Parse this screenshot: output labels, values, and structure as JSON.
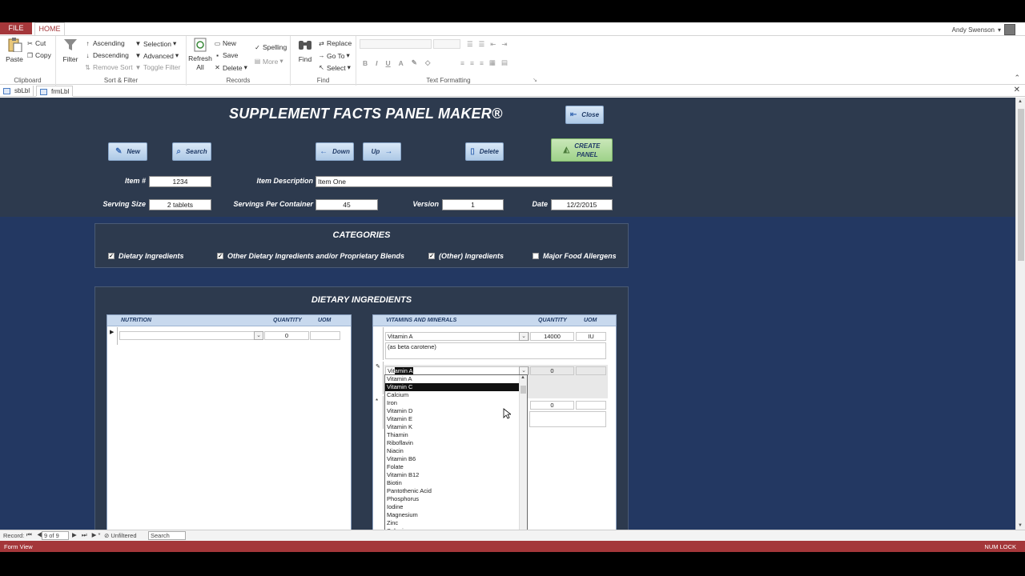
{
  "ribbon": {
    "file_tab": "FILE",
    "home_tab": "HOME",
    "user": "Andy Swenson",
    "clipboard": {
      "paste": "Paste",
      "cut": "Cut",
      "copy": "Copy",
      "label": "Clipboard"
    },
    "sort_filter": {
      "filter": "Filter",
      "ascending": "Ascending",
      "descending": "Descending",
      "remove_sort": "Remove Sort",
      "selection": "Selection",
      "advanced": "Advanced",
      "toggle_filter": "Toggle Filter",
      "label": "Sort & Filter"
    },
    "records": {
      "refresh": "Refresh",
      "refresh_all": "All",
      "new": "New",
      "save": "Save",
      "delete": "Delete",
      "spelling": "Spelling",
      "more": "More",
      "label": "Records"
    },
    "find": {
      "find": "Find",
      "replace": "Replace",
      "go_to": "Go To",
      "select": "Select",
      "label": "Find"
    },
    "text_formatting": {
      "bold": "B",
      "italic": "I",
      "underline": "U",
      "label": "Text Formatting"
    }
  },
  "doc_tabs": [
    "sbLbl",
    "frmLbl"
  ],
  "form": {
    "title": "SUPPLEMENT FACTS PANEL MAKER®",
    "buttons": {
      "close": "Close",
      "new": "New",
      "search": "Search",
      "down": "Down",
      "up": "Up",
      "delete": "Delete",
      "create_line1": "CREATE",
      "create_line2": "PANEL"
    },
    "fields": {
      "item_label": "Item #",
      "item_value": "1234",
      "desc_label": "Item Description",
      "desc_value": "Item One",
      "serving_label": "Serving Size",
      "serving_value": "2 tablets",
      "servings_label": "Servings Per Container",
      "servings_value": "45",
      "version_label": "Version",
      "version_value": "1",
      "date_label": "Date",
      "date_value": "12/2/2015"
    },
    "categories": {
      "title": "CATEGORIES",
      "items": [
        {
          "label": "Dietary Ingredients",
          "checked": true
        },
        {
          "label": "Other Dietary Ingredients and/or Proprietary Blends",
          "checked": true
        },
        {
          "label": "(Other) Ingredients",
          "checked": true
        },
        {
          "label": "Major Food Allergens",
          "checked": false
        }
      ]
    },
    "dietary": {
      "title": "DIETARY INGREDIENTS",
      "nutrition": {
        "col_name": "NUTRITION",
        "col_qty": "QUANTITY",
        "col_uom": "UOM",
        "row_qty": "0"
      },
      "vitamins": {
        "col_name": "VITAMINS AND MINERALS",
        "col_qty": "QUANTITY",
        "col_uom": "UOM",
        "row1_name": "Vitamin A",
        "row1_qty": "14000",
        "row1_uom": "IU",
        "row1_note": "(as beta carotene)",
        "row2_prefix": "Vit",
        "row2_highlight": "amin A",
        "row2_qty": "0",
        "row3_qty": "0"
      },
      "dropdown": [
        "Vitamin A",
        "Vitamin C",
        "Calcium",
        "Iron",
        "Vitamin D",
        "Vitamin E",
        "Vitamin K",
        "Thiamin",
        "Riboflavin",
        "Niacin",
        "Vitamin B6",
        "Folate",
        "Vitamin B12",
        "Biotin",
        "Pantothenic Acid",
        "Phosphorus",
        "Iodine",
        "Magnesium",
        "Zinc",
        "Selenium"
      ],
      "dropdown_selected": 1
    }
  },
  "navbar": {
    "record_label": "Record:",
    "record_value": "9 of 9",
    "filter": "Unfiltered",
    "search": "Search"
  },
  "status": {
    "left": "Form View",
    "right": "NUM LOCK"
  }
}
